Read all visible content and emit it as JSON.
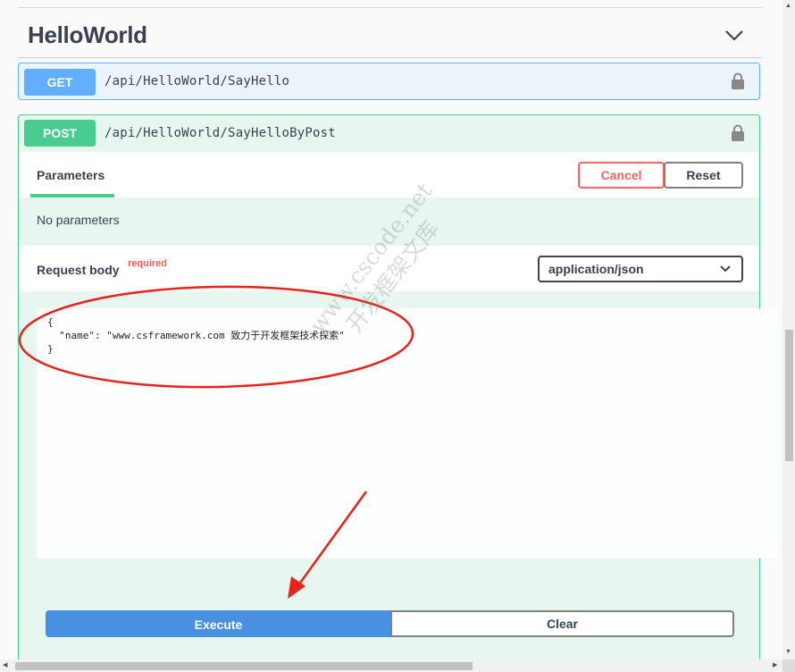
{
  "section": {
    "title": "HelloWorld"
  },
  "get_op": {
    "method": "GET",
    "path": "/api/HelloWorld/SayHello"
  },
  "post_op": {
    "method": "POST",
    "path": "/api/HelloWorld/SayHelloByPost",
    "tab_label": "Parameters",
    "cancel_label": "Cancel",
    "reset_label": "Reset",
    "no_params": "No parameters",
    "request_body_label": "Request body",
    "required_label": "required",
    "content_type": "application/json",
    "body_text": "{\n  \"name\": \"www.csframework.com 致力于开发框架技术探索\"\n}",
    "execute_label": "Execute",
    "clear_label": "Clear"
  },
  "watermark": {
    "line1": "www.cscode.net",
    "line2": "开发框架文库"
  },
  "colors": {
    "get": "#61affe",
    "post": "#49cc90",
    "cancel": "#ff6060",
    "execute": "#4990e2",
    "annotation": "#e82319"
  },
  "icons": [
    "chevron-down-icon",
    "lock-icon",
    "lock-icon",
    "chevron-down-icon"
  ]
}
